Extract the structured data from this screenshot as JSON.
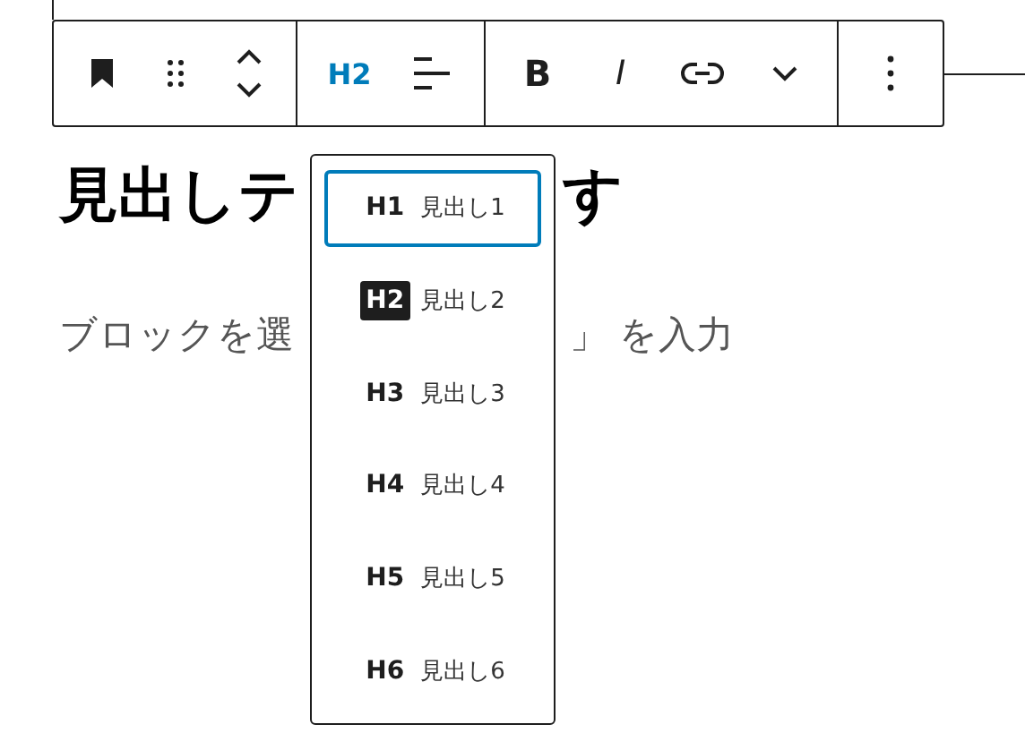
{
  "toolbar": {
    "heading_button": "H2",
    "heading_button_active": true,
    "bold_button": "B",
    "italic_button": "I"
  },
  "heading_parts": [
    "見出しテ",
    "す"
  ],
  "paragraph_parts": [
    "ブロックを選",
    "」 を入力"
  ],
  "heading_menu": [
    {
      "tag": "H1",
      "label": "見出し1",
      "focused": true,
      "selected": false
    },
    {
      "tag": "H2",
      "label": "見出し2",
      "focused": false,
      "selected": true
    },
    {
      "tag": "H3",
      "label": "見出し3",
      "focused": false,
      "selected": false
    },
    {
      "tag": "H4",
      "label": "見出し4",
      "focused": false,
      "selected": false
    },
    {
      "tag": "H5",
      "label": "見出し5",
      "focused": false,
      "selected": false
    },
    {
      "tag": "H6",
      "label": "見出し6",
      "focused": false,
      "selected": false
    }
  ]
}
